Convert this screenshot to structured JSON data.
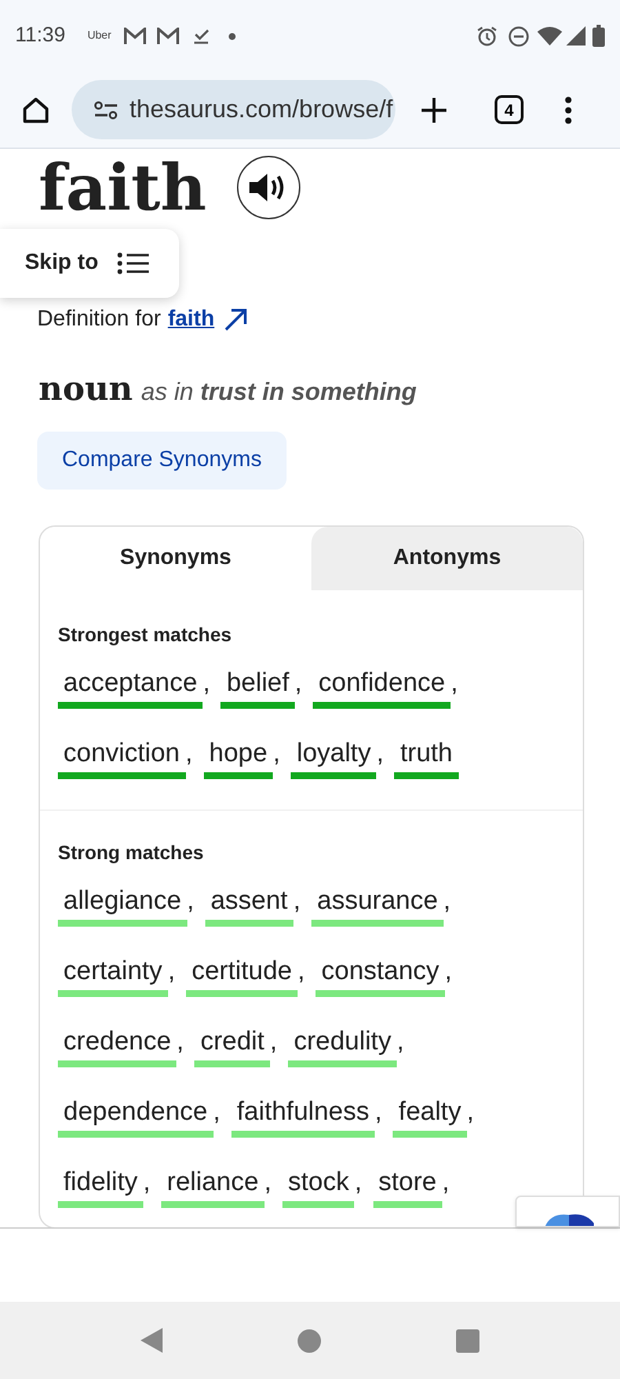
{
  "status_bar": {
    "time": "11:39",
    "app_label": "Uber"
  },
  "browser": {
    "url": "thesaurus.com/browse/f",
    "tab_count": "4"
  },
  "entry": {
    "word": "faith",
    "skip_to": "Skip to",
    "definition_prefix": "Definition for",
    "definition_link": "faith"
  },
  "sense": {
    "part_of_speech": "noun",
    "as_in": "as in",
    "meaning": "trust in something"
  },
  "compare_button": "Compare Synonyms",
  "tabs": [
    {
      "label": "Synonyms",
      "selected": true
    },
    {
      "label": "Antonyms",
      "selected": false
    }
  ],
  "groups": [
    {
      "heading": "Strongest matches",
      "color": "#12a81f",
      "words": [
        {
          "text": "acceptance",
          "separator": ","
        },
        {
          "text": "belief",
          "separator": ","
        },
        {
          "text": "confidence",
          "separator": ","
        },
        {
          "text": "conviction",
          "separator": ","
        },
        {
          "text": "hope",
          "separator": ","
        },
        {
          "text": "loyalty",
          "separator": ","
        },
        {
          "text": "truth"
        }
      ]
    },
    {
      "heading": "Strong matches",
      "color": "#7ce87f",
      "words": [
        {
          "text": "allegiance",
          "separator": ","
        },
        {
          "text": "assent",
          "separator": ","
        },
        {
          "text": "assurance",
          "separator": ","
        },
        {
          "text": "certainty",
          "separator": ","
        },
        {
          "text": "certitude",
          "separator": ","
        },
        {
          "text": "constancy",
          "separator": ","
        },
        {
          "text": "credence",
          "separator": ","
        },
        {
          "text": "credit",
          "separator": ","
        },
        {
          "text": "credulity",
          "separator": ","
        },
        {
          "text": "dependence",
          "separator": ","
        },
        {
          "text": "faithfulness",
          "separator": ","
        },
        {
          "text": "fealty",
          "separator": ","
        },
        {
          "text": "fidelity",
          "separator": ","
        },
        {
          "text": "reliance",
          "separator": ","
        },
        {
          "text": "stock",
          "separator": ","
        },
        {
          "text": "store",
          "separator": ","
        }
      ]
    }
  ]
}
